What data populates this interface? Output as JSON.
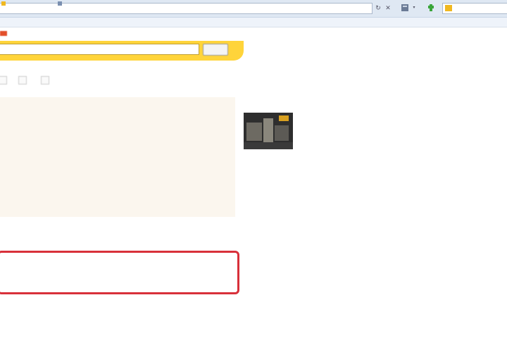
{
  "browser": {
    "address_text": "",
    "search_placeholder": "",
    "icons": [
      "refresh-icon",
      "close-icon",
      "page-icon",
      "home-icon",
      "star-icon"
    ],
    "favorites": [
      {
        "label": ""
      },
      {
        "label": ""
      }
    ]
  },
  "yandex": {
    "nav_items": [
      "",
      "",
      "",
      "",
      "",
      "",
      "",
      ""
    ],
    "query": "",
    "search_button": "",
    "options": "",
    "filters": [
      "",
      "",
      ""
    ],
    "ads_label": ""
  },
  "results": {
    "ads": [
      {
        "title": "",
        "lines": [
          "",
          ""
        ],
        "url": ""
      },
      {
        "title": "",
        "lines": [
          "",
          ""
        ],
        "url": ""
      },
      {
        "title": "",
        "lines": [
          "",
          ""
        ],
        "url": ""
      }
    ],
    "organic": [
      {
        "title": "",
        "lines": [
          "",
          ""
        ],
        "url": ""
      },
      {
        "title": "",
        "lines": [
          "",
          ""
        ],
        "url": "",
        "highlighted": true
      },
      {
        "title": "",
        "lines": [
          "",
          ""
        ],
        "url": ""
      }
    ]
  },
  "sidebar": {
    "top_link": "",
    "top_text": "",
    "video_label": "",
    "video_caption": "",
    "video_link": ""
  },
  "colors": {
    "yandex_yellow": "#ffd43a",
    "link_blue": "#1a2fd0",
    "url_green": "#3b9a2a",
    "highlight_red": "#d8303a",
    "ads_background": "#fbf6ee"
  }
}
